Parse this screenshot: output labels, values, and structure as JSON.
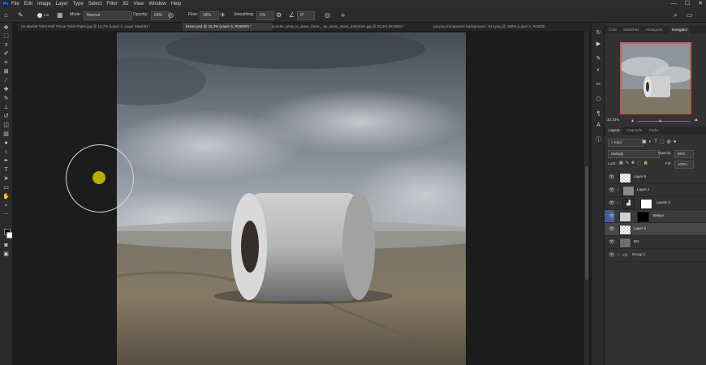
{
  "app": {
    "logo": "Ps"
  },
  "menu": [
    "File",
    "Edit",
    "Image",
    "Layer",
    "Type",
    "Select",
    "Filter",
    "3D",
    "View",
    "Window",
    "Help"
  ],
  "window_controls": {
    "minimize": "—",
    "maximize": "☐",
    "close": "✕"
  },
  "options": {
    "brush_size": "700",
    "mode_label": "Mode:",
    "mode_value": "Normal",
    "opacity_label": "Opacity:",
    "opacity_value": "63%",
    "flow_label": "Flow:",
    "flow_value": "28%",
    "smoothing_label": "Smoothing:",
    "smoothing_value": "2%",
    "angle_value": "0°"
  },
  "tabs": [
    {
      "label": "Us Market Toilet Roll Tissue Toilet Paper.jpg @ 16,7% (Layer 0, Layer Mask/8) *"
    },
    {
      "label": "tissue.psd @ 33,3% (Layer 5, RGB/8#) *"
    },
    {
      "label": "wonder_what_is_down_there__by_sirius_stock_d462s3m.jpg @ 33,3% (RGB/8) *"
    },
    {
      "label": "cat png transparent background - 624.png @ 100% (Layer 1, RGB/8)"
    }
  ],
  "panel_tabs_top": [
    "Color",
    "Swatches",
    "Histogram",
    "Navigator"
  ],
  "navigator": {
    "zoom": "33,33%"
  },
  "panel_tabs_layers": [
    "Layers",
    "Channels",
    "Paths"
  ],
  "layers_panel": {
    "filter_kind": "Kind",
    "blend_mode": "Multiply",
    "opacity_label": "Opacity:",
    "opacity_value": "86%",
    "lock_label": "Lock:",
    "fill_label": "Fill:",
    "fill_value": "100%",
    "layers": [
      {
        "name": "Layer 6",
        "selected": false
      },
      {
        "name": "Layer 4",
        "selected": false
      },
      {
        "name": "Levels 3",
        "selected": false
      },
      {
        "name": "Bевых",
        "selected": false
      },
      {
        "name": "Layer 5",
        "selected": true
      },
      {
        "name": "BG",
        "selected": false
      },
      {
        "name": "Group 1",
        "selected": false
      }
    ]
  },
  "colors": {
    "accent": "#31a8ff",
    "navigator_box": "#e0443a",
    "brush_dot": "#b8b000"
  }
}
